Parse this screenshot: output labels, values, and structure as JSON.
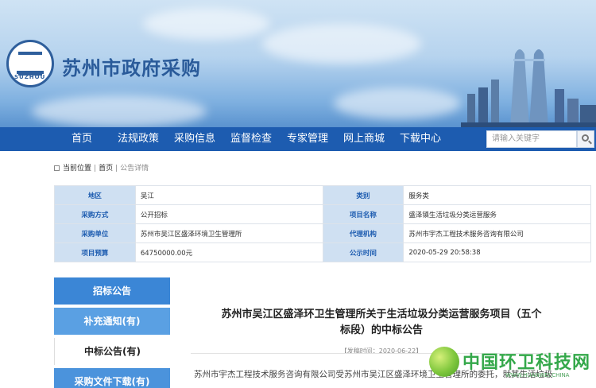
{
  "header": {
    "seal_text": "SUZHOU",
    "site_title": "苏州市政府采购"
  },
  "nav": {
    "items": [
      "首页",
      "法规政策",
      "采购信息",
      "监督检查",
      "专家管理",
      "网上商城",
      "下载中心"
    ],
    "search_placeholder": "请输入关键字"
  },
  "breadcrumb": {
    "label": "当前位置",
    "home": "首页",
    "current": "公告详情"
  },
  "info": {
    "rows": [
      {
        "k1": "地区",
        "v1": "吴江",
        "k2": "类别",
        "v2": "服务类"
      },
      {
        "k1": "采购方式",
        "v1": "公开招标",
        "k2": "项目名称",
        "v2": "盛泽镇生活垃圾分类运营服务"
      },
      {
        "k1": "采购单位",
        "v1": "苏州市吴江区盛泽环境卫生管理所",
        "k2": "代理机构",
        "v2": "苏州市宇杰工程技术服务咨询有限公司"
      },
      {
        "k1": "项目预算",
        "v1": "64750000.00元",
        "k2": "公示时间",
        "v2": "2020-05-29 20:58:38"
      }
    ]
  },
  "sidebar": {
    "items": [
      {
        "label": "招标公告",
        "color": "#3b86d6"
      },
      {
        "label": "补充通知(有)",
        "color": "#5aa0e3"
      },
      {
        "label": "中标公告(有)",
        "color": "#ffffff"
      },
      {
        "label": "采购文件下载(有)",
        "color": "#4b93dc"
      }
    ]
  },
  "article": {
    "title_line1": "苏州市吴江区盛泽环卫生管理所关于生活垃圾分类运营服务项目（五个",
    "title_line2": "标段）的中标公告",
    "pubdate": "【发稿时间：2020-06-22】",
    "body_line1": "苏州市宇杰工程技术服务咨询有限公司受苏州市吴江区盛泽环境卫生管理所的委托，就其生活垃圾"
  },
  "watermark": {
    "text": "中国环卫科技网",
    "sub": "WWW.HUANWEI.CHINA"
  }
}
